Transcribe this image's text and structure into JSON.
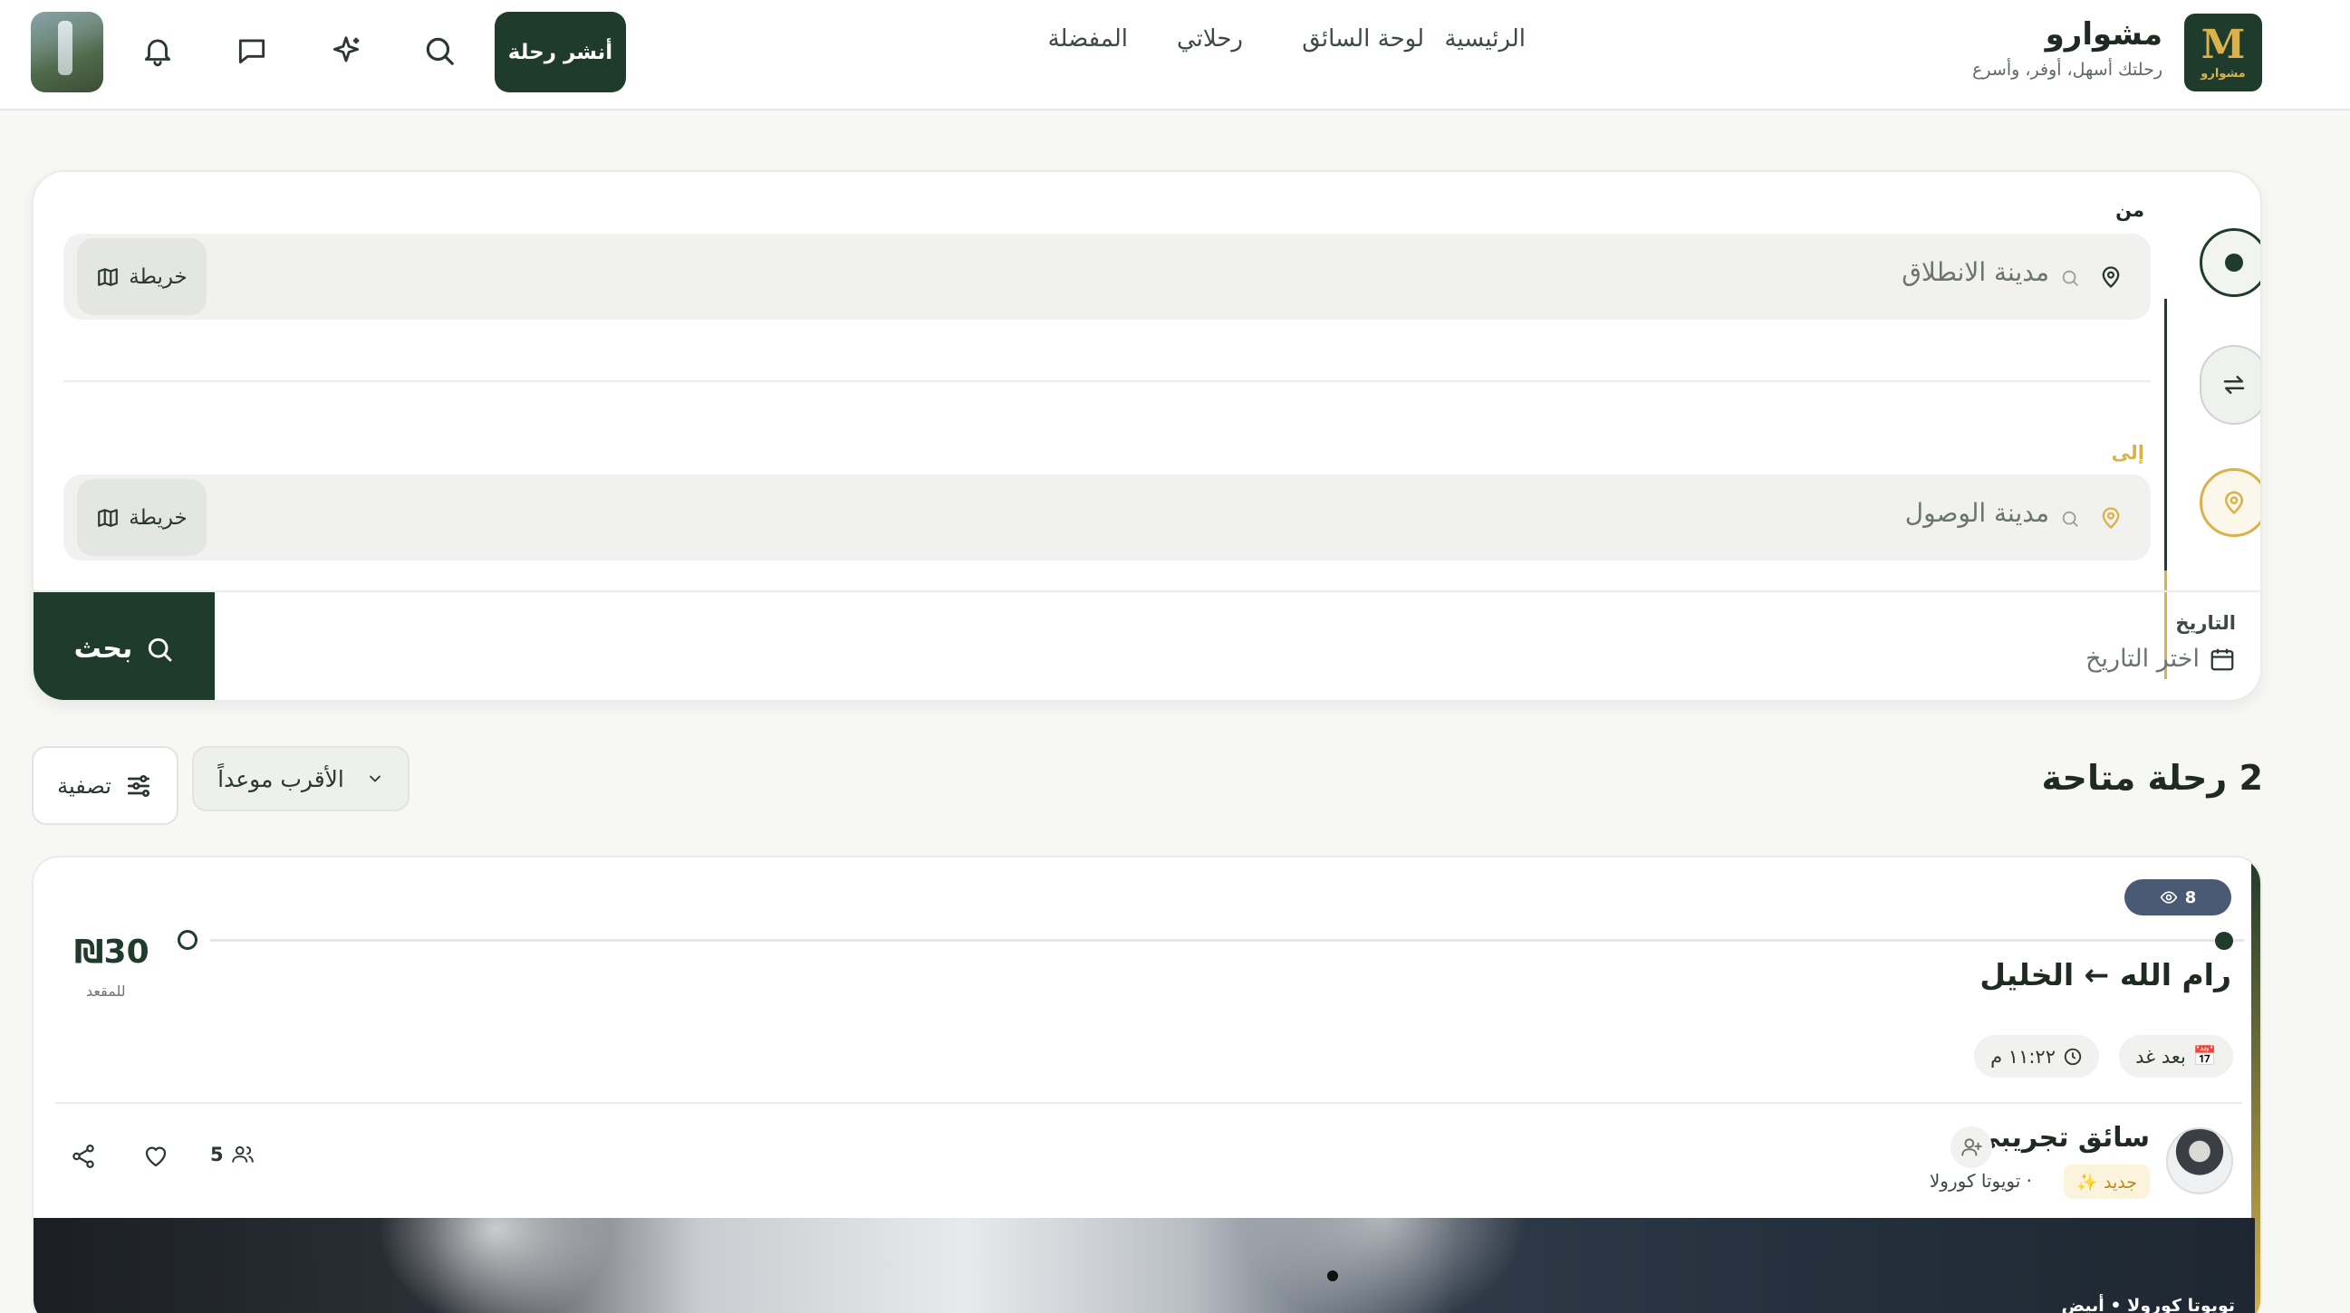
{
  "header": {
    "brand_name": "مشوارو",
    "brand_tagline": "رحلتك أسهل، أوفر، وأسرع",
    "logo_text": "مشوارو",
    "nav": [
      "الرئيسية",
      "لوحة السائق",
      "رحلاتي",
      "المفضلة"
    ],
    "publish_label": "أنشر رحلة",
    "icons": [
      "search-icon",
      "sparkle-icon",
      "chat-icon",
      "bell-icon"
    ]
  },
  "search": {
    "from_label": "من",
    "from_placeholder": "مدينة الانطلاق",
    "to_label": "إلى",
    "to_placeholder": "مدينة الوصول",
    "map_label": "خريطة",
    "date_label": "التاريخ",
    "date_placeholder": "اختر التاريخ",
    "search_label": "بحث"
  },
  "results": {
    "title": "2 رحلة متاحة",
    "sort_label": "الأقرب موعداً",
    "filter_label": "تصفية"
  },
  "trip": {
    "views": "8",
    "route": "رام الله ← الخليل",
    "price": "₪30",
    "price_unit": "للمقعد",
    "day": "بعد غد",
    "time": "١١:٢٢ م",
    "driver_name": "سائق تجريبي",
    "new_badge": "جديد ✨",
    "car_model": "· تويوتا كورولا",
    "seats": "5",
    "car_caption": "تويوتا كورولا • أبيض"
  },
  "colors": {
    "primary": "#1f3b2b",
    "accent": "#d9b24c",
    "background": "#f7f7f5"
  }
}
